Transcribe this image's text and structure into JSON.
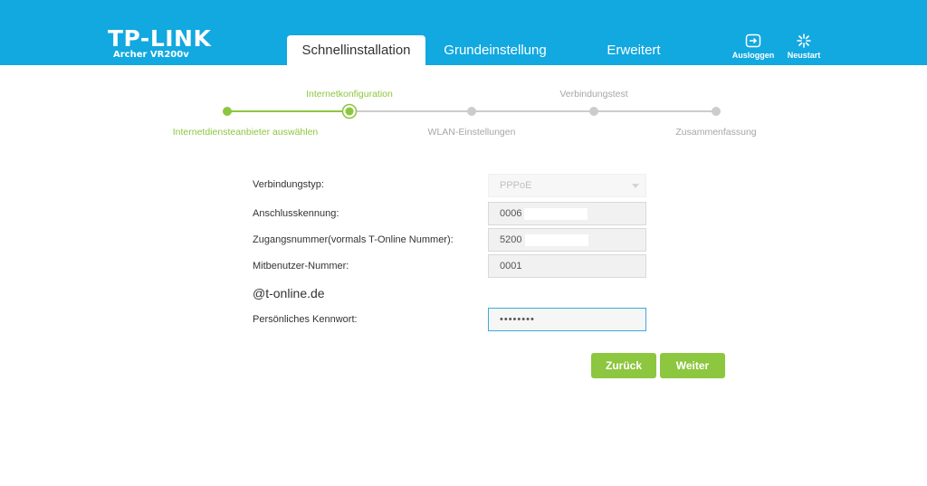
{
  "header": {
    "logo": "TP-LINK",
    "model": "Archer VR200v",
    "tabs": [
      {
        "label": "Schnellinstallation",
        "active": true
      },
      {
        "label": "Grundeinstellung",
        "active": false
      },
      {
        "label": "Erweitert",
        "active": false
      }
    ],
    "logout_label": "Ausloggen",
    "restart_label": "Neustart"
  },
  "stepper": {
    "top_labels": [
      "Internetkonfiguration",
      "Verbindungstest"
    ],
    "bottom_labels": [
      "Internetdiensteanbieter auswählen",
      "WLAN-Einstellungen",
      "Zusammenfassung"
    ],
    "steps_total": 5,
    "current_step": 2,
    "colors": {
      "done": "#8dc63f",
      "pending": "#cccccc"
    }
  },
  "form": {
    "connection_type_label": "Verbindungstyp:",
    "connection_type_value": "PPPoE",
    "account_id_label": "Anschlusskennung:",
    "account_id_value": "0006",
    "access_number_label": "Zugangsnummer(vormals T-Online Nummer):",
    "access_number_value": "5200",
    "co_user_label": "Mitbenutzer-Nummer:",
    "co_user_value": "0001",
    "domain_suffix": "@t-online.de",
    "password_label": "Persönliches Kennwort:",
    "password_value": "••••••••"
  },
  "buttons": {
    "back": "Zurück",
    "next": "Weiter"
  },
  "colors": {
    "header": "#12a8e0",
    "accent_green": "#8dc63f",
    "focus_border": "#3fa9dc"
  }
}
